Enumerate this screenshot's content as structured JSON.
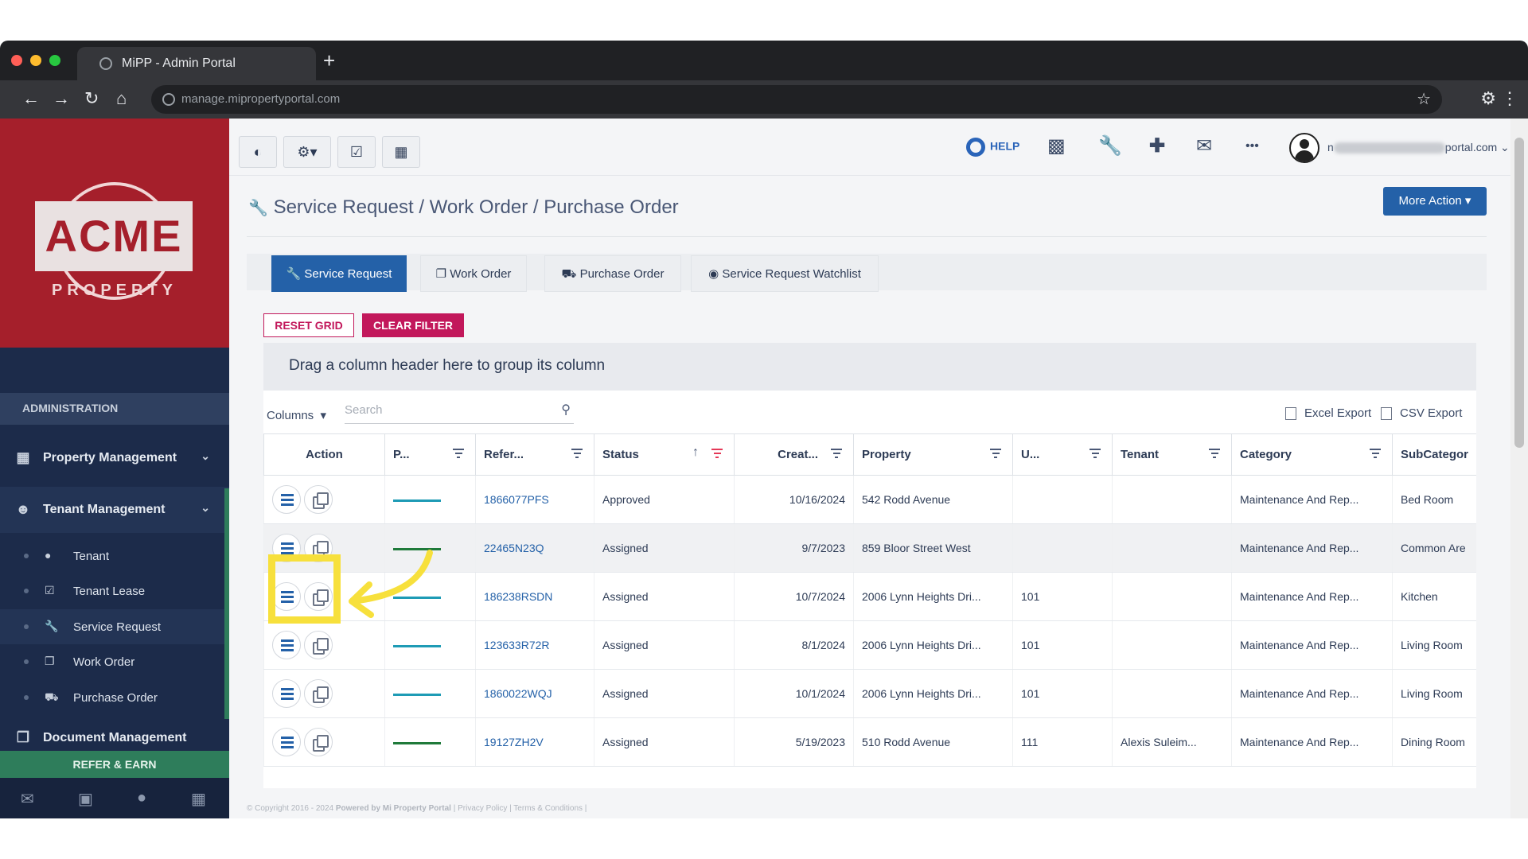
{
  "browser": {
    "tab_title": "MiPP - Admin Portal",
    "new_tab": "+",
    "url": "manage.mipropertyportal.com"
  },
  "sidebar": {
    "logo_text": "ACME",
    "logo_sub": "PROPERTY",
    "section_header": "ADMINISTRATION",
    "groups": [
      {
        "label": "Property Management"
      },
      {
        "label": "Tenant Management"
      },
      {
        "label": "Document Management"
      }
    ],
    "subitems": [
      {
        "label": "Tenant"
      },
      {
        "label": "Tenant Lease"
      },
      {
        "label": "Service Request"
      },
      {
        "label": "Work Order"
      },
      {
        "label": "Purchase Order"
      }
    ],
    "refer": "REFER & EARN"
  },
  "topbar": {
    "help": "HELP",
    "more": "•••",
    "user_email_suffix": "portal.com",
    "user_email_prefix": "n"
  },
  "page": {
    "title": "Service Request / Work Order / Purchase Order",
    "more_action": "More Action ▾",
    "tabs": [
      {
        "label": "Service Request"
      },
      {
        "label": "Work Order"
      },
      {
        "label": "Purchase Order"
      },
      {
        "label": "Service Request Watchlist"
      }
    ],
    "reset_grid": "RESET GRID",
    "clear_filter": "CLEAR FILTER",
    "group_hint": "Drag a column header here to group its column",
    "columns": "Columns",
    "search_placeholder": "Search",
    "excel_export": "Excel Export",
    "csv_export": "CSV Export"
  },
  "grid": {
    "headers": {
      "action": "Action",
      "priority": "P...",
      "reference": "Refer...",
      "status": "Status",
      "created": "Creat...",
      "property": "Property",
      "unit": "U...",
      "tenant": "Tenant",
      "category": "Category",
      "subcategory": "SubCategor"
    },
    "rows": [
      {
        "priority_color": "#1e9bb5",
        "reference": "1866077PFS",
        "status": "Approved",
        "created": "10/16/2024",
        "property": "542 Rodd Avenue",
        "unit": "",
        "tenant": "",
        "category": "Maintenance And Rep...",
        "subcategory": "Bed Room"
      },
      {
        "priority_color": "#1f7a3a",
        "reference": "22465N23Q",
        "status": "Assigned",
        "created": "9/7/2023",
        "property": "859 Bloor Street West",
        "unit": "",
        "tenant": "",
        "category": "Maintenance And Rep...",
        "subcategory": "Common Are"
      },
      {
        "priority_color": "#1e9bb5",
        "reference": "186238RSDN",
        "status": "Assigned",
        "created": "10/7/2024",
        "property": "2006 Lynn Heights Dri...",
        "unit": "101",
        "tenant": "",
        "category": "Maintenance And Rep...",
        "subcategory": "Kitchen"
      },
      {
        "priority_color": "#1e9bb5",
        "reference": "123633R72R",
        "status": "Assigned",
        "created": "8/1/2024",
        "property": "2006 Lynn Heights Dri...",
        "unit": "101",
        "tenant": "",
        "category": "Maintenance And Rep...",
        "subcategory": "Living Room"
      },
      {
        "priority_color": "#1e9bb5",
        "reference": "1860022WQJ",
        "status": "Assigned",
        "created": "10/1/2024",
        "property": "2006 Lynn Heights Dri...",
        "unit": "101",
        "tenant": "",
        "category": "Maintenance And Rep...",
        "subcategory": "Living Room"
      },
      {
        "priority_color": "#1f7a3a",
        "reference": "19127ZH2V",
        "status": "Assigned",
        "created": "5/19/2023",
        "property": "510 Rodd Avenue",
        "unit": "111",
        "tenant": "Alexis Suleim...",
        "category": "Maintenance And Rep...",
        "subcategory": "Dining Room"
      }
    ]
  },
  "footer": {
    "copyright": "© Copyright 2016 - 2024",
    "powered": "Powered by Mi Property Portal",
    "links": "| Privacy Policy | Terms & Conditions |"
  },
  "colors": {
    "brand_red": "#a51f2b",
    "sidebar_navy": "#1c2b4a",
    "accent_blue": "#2461a8",
    "filter_pink": "#c2185b",
    "highlight_yellow": "#f7e03c"
  }
}
